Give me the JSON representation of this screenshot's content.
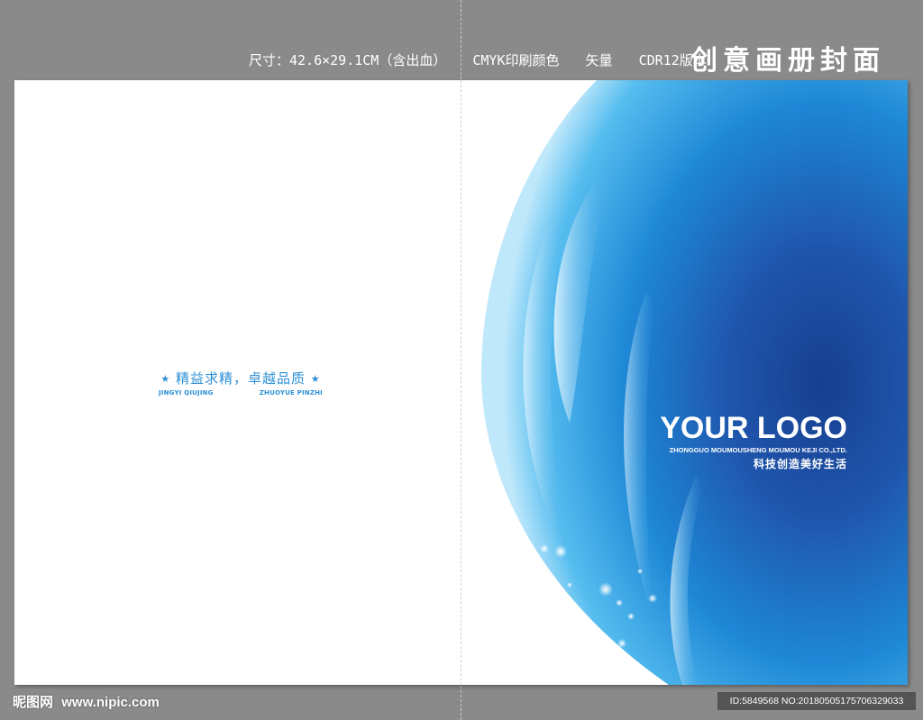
{
  "header": {
    "specs": [
      "尺寸：42.6×29.1CM（含出血）",
      "CMYK印刷颜色",
      "矢量",
      "CDR12版本"
    ],
    "title": "创意画册封面"
  },
  "back_cover": {
    "star_left": "★",
    "slogan_cn": "精益求精，卓越品质",
    "star_right": "★",
    "slogan_en_left": "JINGYI QIUJING",
    "slogan_en_right": "ZHUOYUE PINZHI",
    "accent_color": "#2b8fd6"
  },
  "front_cover": {
    "logo_title": "YOUR LOGO",
    "company": "ZHONGGUO MOUMOUSHENG MOUMOU KEJI CO.,LTD.",
    "slogan": "科技创造美好生活",
    "colors": {
      "deep_blue": "#1f4fa0",
      "mid_blue": "#1e8ed8",
      "light_blue": "#7fd0f5"
    }
  },
  "watermark": {
    "site_cn": "昵图网",
    "site_url": "www.nipic.com",
    "id_text": "ID:5849568 NO:20180505175706329033"
  }
}
